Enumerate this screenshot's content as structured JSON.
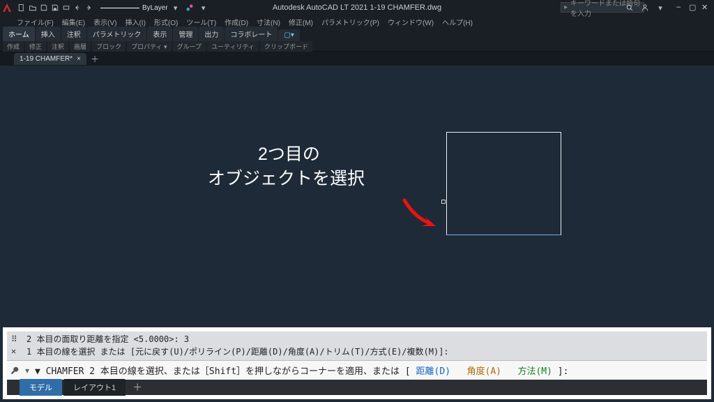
{
  "title": "Autodesk AutoCAD LT 2021   1-19 CHAMFER.dwg",
  "search_placeholder": "キーワードまたは語句を入力",
  "layer_name": "ByLayer",
  "menu": [
    "ファイル(F)",
    "編集(E)",
    "表示(V)",
    "挿入(I)",
    "形式(O)",
    "ツール(T)",
    "作成(D)",
    "寸法(N)",
    "修正(M)",
    "パラメトリック(P)",
    "ウィンドウ(W)",
    "ヘルプ(H)"
  ],
  "ribbon_tabs": [
    "ホーム",
    "挿入",
    "注釈",
    "パラメトリック",
    "表示",
    "管理",
    "出力",
    "コラボレート"
  ],
  "ribbon_panels": [
    "作成",
    "修正",
    "注釈",
    "画層",
    "ブロック",
    "プロパティ ▾",
    "グループ",
    "ユーティリティ",
    "クリップボード"
  ],
  "file_tab": "1-19 CHAMFER*",
  "overlay": {
    "line1": "2つ目の",
    "line2": "オブジェクトを選択"
  },
  "cmd": {
    "line1_pre": "2 本目の面取り距離を指定 <5.0000>: 3",
    "line2_pre": "1 本目の線を選択 または [元に戻す(U)/ポリライン(P)/距離(D)/角度(A)/トリム(T)/方式(E)/複数(M)]:",
    "prompt_lead": "▼ CHAMFER 2 本目の線を選択、または［Shift］を押しながらコーナーを適用、または [",
    "opt_d": "距離(D)",
    "opt_a": "角度(A)",
    "opt_m": "方法(M)",
    "prompt_tail": "]:"
  },
  "model_tabs": {
    "model": "モデル",
    "layout1": "レイアウト1"
  }
}
